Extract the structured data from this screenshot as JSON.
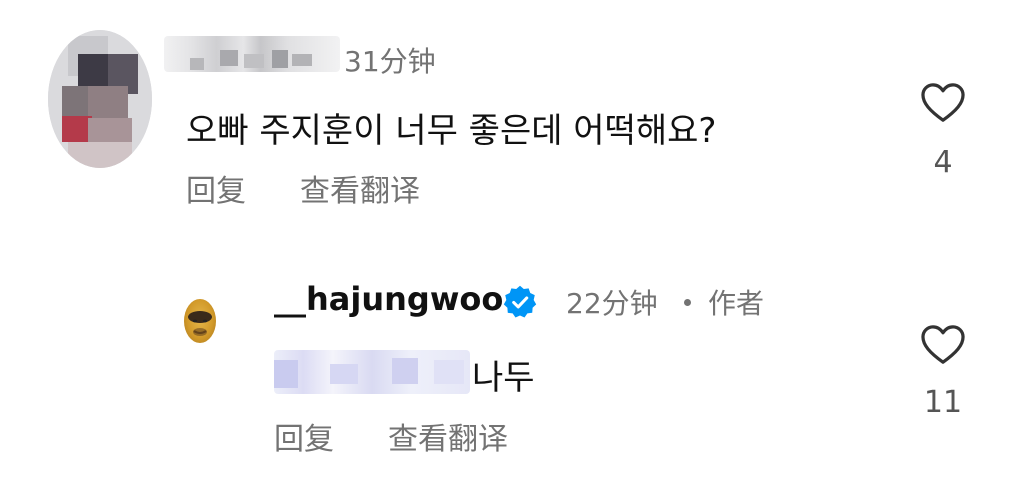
{
  "comments": [
    {
      "time": "31分钟",
      "text": "오빠 주지훈이 너무 좋은데 어떡해요?",
      "reply_label": "回复",
      "translate_label": "查看翻译",
      "like_count": "4"
    },
    {
      "username": "__hajungwoo",
      "time": "22分钟",
      "author_tag": "作者",
      "text_after_mention": "나두",
      "reply_label": "回复",
      "translate_label": "查看翻译",
      "like_count": "11"
    }
  ],
  "icons": {
    "like": "heart-outline-icon",
    "verified": "verified-badge-icon"
  },
  "colors": {
    "verified_blue": "#0095f6",
    "secondary_text": "#737373",
    "primary_text": "#111111"
  }
}
